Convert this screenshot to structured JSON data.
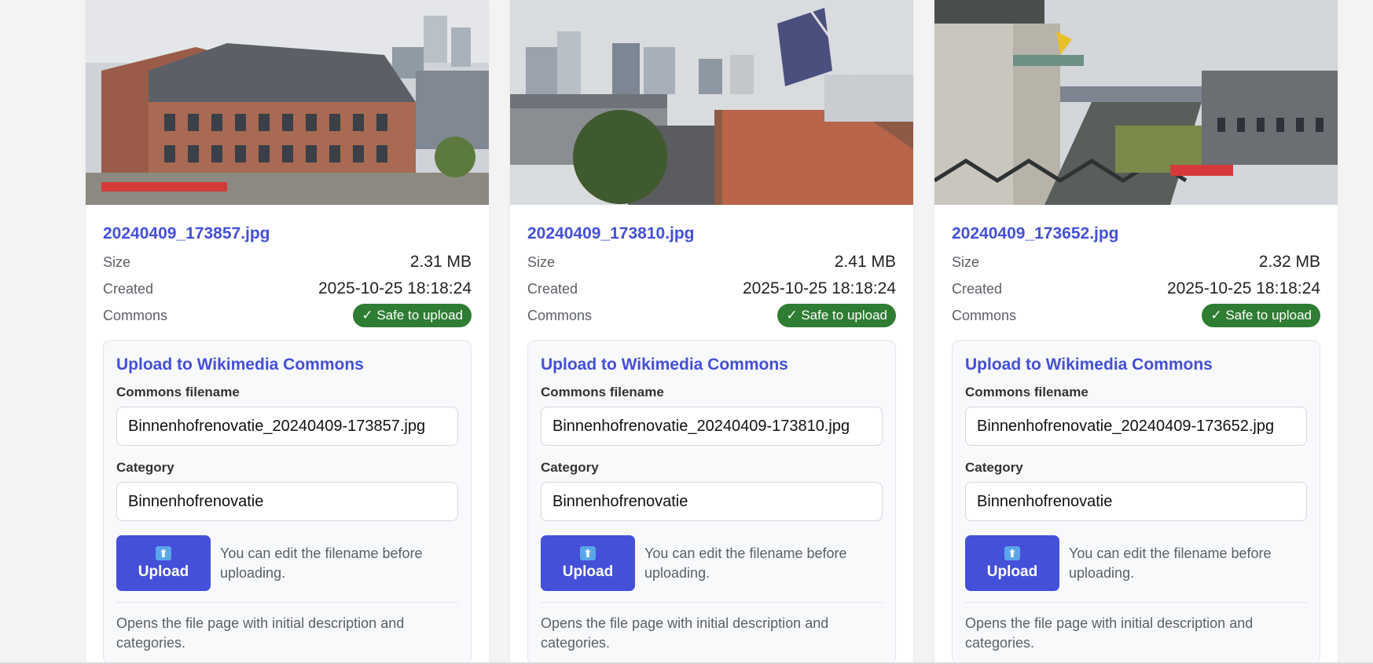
{
  "cards": [
    {
      "filename": "20240409_173857.jpg",
      "size_label": "Size",
      "size_value": "2.31 MB",
      "created_label": "Created",
      "created_value": "2025-10-25 18:18:24",
      "commons_label": "Commons",
      "commons_badge": "✓ Safe to upload",
      "upload_title": "Upload to Wikimedia Commons",
      "filename_label": "Commons filename",
      "filename_value": "Binnenhofrenovatie_20240409-173857.jpg",
      "category_label": "Category",
      "category_value": "Binnenhofrenovatie",
      "upload_icon": "⬆",
      "upload_button": "Upload",
      "hint": "You can edit the filename before uploading.",
      "footnote": "Opens the file page with initial description and categories."
    },
    {
      "filename": "20240409_173810.jpg",
      "size_label": "Size",
      "size_value": "2.41 MB",
      "created_label": "Created",
      "created_value": "2025-10-25 18:18:24",
      "commons_label": "Commons",
      "commons_badge": "✓ Safe to upload",
      "upload_title": "Upload to Wikimedia Commons",
      "filename_label": "Commons filename",
      "filename_value": "Binnenhofrenovatie_20240409-173810.jpg",
      "category_label": "Category",
      "category_value": "Binnenhofrenovatie",
      "upload_icon": "⬆",
      "upload_button": "Upload",
      "hint": "You can edit the filename before uploading.",
      "footnote": "Opens the file page with initial description and categories."
    },
    {
      "filename": "20240409_173652.jpg",
      "size_label": "Size",
      "size_value": "2.32 MB",
      "created_label": "Created",
      "created_value": "2025-10-25 18:18:24",
      "commons_label": "Commons",
      "commons_badge": "✓ Safe to upload",
      "upload_title": "Upload to Wikimedia Commons",
      "filename_label": "Commons filename",
      "filename_value": "Binnenhofrenovatie_20240409-173652.jpg",
      "category_label": "Category",
      "category_value": "Binnenhofrenovatie",
      "upload_icon": "⬆",
      "upload_button": "Upload",
      "hint": "You can edit the filename before uploading.",
      "footnote": "Opens the file page with initial description and categories."
    }
  ],
  "colors": {
    "accent": "#4450d8",
    "safe_badge": "#2e7d32",
    "background": "#f3f3f4"
  }
}
